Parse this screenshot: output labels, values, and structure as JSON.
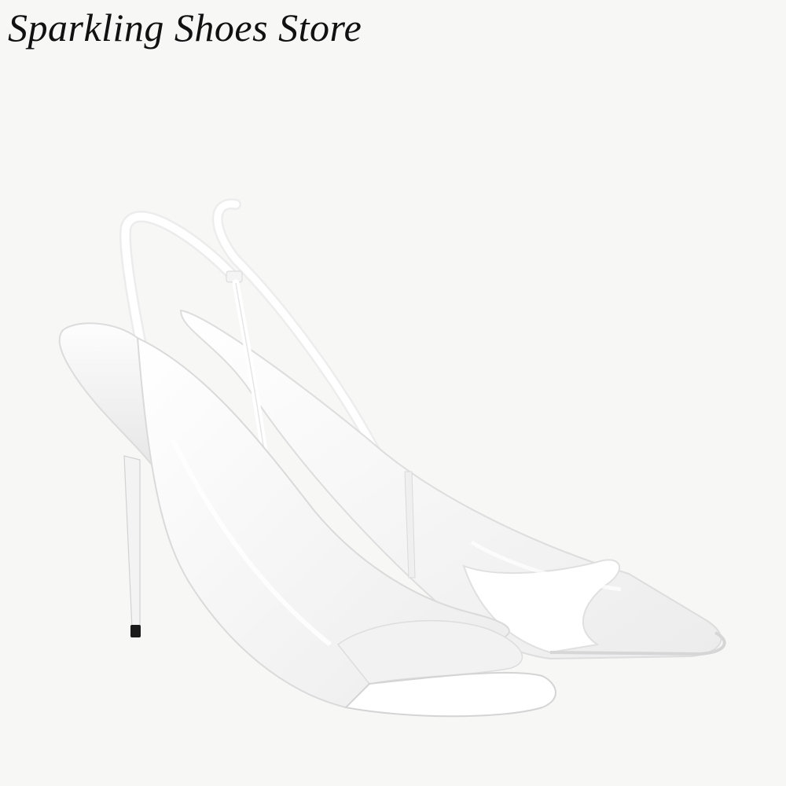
{
  "header": {
    "store_name": "Sparkling Shoes Store"
  },
  "product": {
    "image_subject": "pair-of-white-slingback-stiletto-sandals",
    "colors": {
      "background": "#f7f7f6",
      "shoe_main": "#ffffff",
      "shoe_shadow": "#e4e4e4",
      "heel_tip": "#1a1a1a"
    }
  }
}
